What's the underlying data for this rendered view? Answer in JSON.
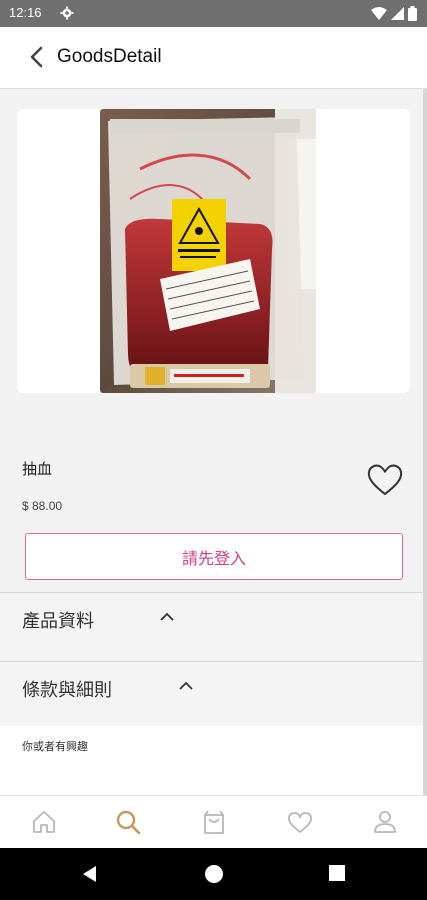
{
  "status_bar": {
    "time": "12:16"
  },
  "app_bar": {
    "title": "GoodsDetail"
  },
  "product": {
    "name": "抽血",
    "price": "$ 88.00",
    "login_button_label": "請先登入",
    "photo": {
      "bag_label": "BIOHAZARD",
      "tube_label": "THORNEY"
    }
  },
  "sections": [
    {
      "label": "產品資料"
    },
    {
      "label": "條款與細則"
    }
  ],
  "interest": {
    "label": "你或者有興趣"
  },
  "bottom_nav": {
    "items": [
      "home-icon",
      "search-icon",
      "cart-icon",
      "heart-icon",
      "profile-icon"
    ],
    "active_color": "#c49a5a",
    "inactive_color": "#b7b7b7"
  },
  "colors": {
    "accent": "#d33d87",
    "status_bar": "#6f6f6f"
  }
}
